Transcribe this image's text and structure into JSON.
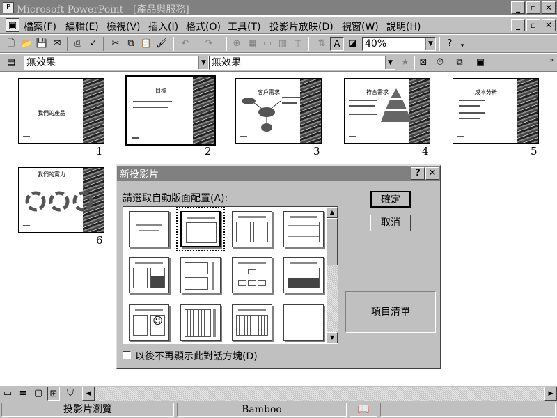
{
  "window": {
    "title": "Microsoft PowerPoint - [產品與服務]",
    "icon": "powerpoint-app-icon"
  },
  "menu": [
    "檔案(F)",
    "編輯(E)",
    "檢視(V)",
    "插入(I)",
    "格式(O)",
    "工具(T)",
    "投影片放映(D)",
    "視窗(W)",
    "說明(H)"
  ],
  "toolbar": {
    "zoom": "40%"
  },
  "toolbar2": {
    "effect1": "無效果",
    "effect2": "無效果"
  },
  "slides": [
    {
      "num": "1",
      "title": "我們的產品"
    },
    {
      "num": "2",
      "title": "目標"
    },
    {
      "num": "3",
      "title": "客戶需求"
    },
    {
      "num": "4",
      "title": "符合需求"
    },
    {
      "num": "5",
      "title": "成本分析"
    },
    {
      "num": "6",
      "title": "我們的實力"
    }
  ],
  "dialog": {
    "title": "新投影片",
    "prompt": "請選取自動版面配置(A):",
    "ok": "確定",
    "cancel": "取消",
    "preview_label": "項目清單",
    "checkbox_label": "以後不再顯示此對話方塊(D)"
  },
  "status": {
    "view": "投影片瀏覽",
    "design": "Bamboo"
  }
}
